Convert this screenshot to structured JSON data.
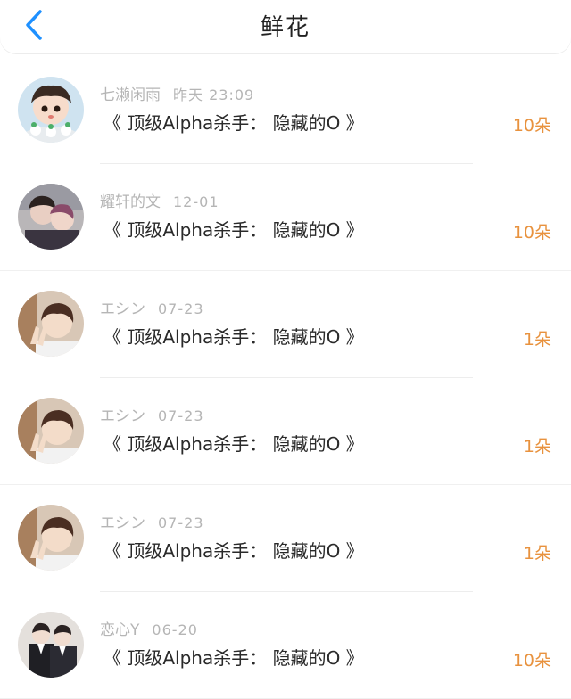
{
  "header": {
    "title": "鲜花",
    "accent_color": "#1e90ff"
  },
  "items": [
    {
      "name": "七濑闲雨",
      "time": "昨天 23:09",
      "book": "《 顶级Alpha杀手： 隐藏的O 》",
      "count": "10朵",
      "avatar": "cartoon-girl-avatar"
    },
    {
      "name": "耀轩的文",
      "time": "12-01",
      "book": "《 顶级Alpha杀手： 隐藏的O 》",
      "count": "10朵",
      "avatar": "couple-photo-avatar"
    },
    {
      "name": "エシン",
      "time": "07-23",
      "book": "《 顶级Alpha杀手： 隐藏的O 》",
      "count": "1朵",
      "avatar": "boy-peace-sign-avatar"
    },
    {
      "name": "エシン",
      "time": "07-23",
      "book": "《 顶级Alpha杀手： 隐藏的O 》",
      "count": "1朵",
      "avatar": "boy-peace-sign-avatar"
    },
    {
      "name": "エシン",
      "time": "07-23",
      "book": "《 顶级Alpha杀手： 隐藏的O 》",
      "count": "1朵",
      "avatar": "boy-peace-sign-avatar"
    },
    {
      "name": "恋心Y",
      "time": "06-20",
      "book": "《 顶级Alpha杀手： 隐藏的O 》",
      "count": "10朵",
      "avatar": "two-boys-avatar"
    }
  ]
}
